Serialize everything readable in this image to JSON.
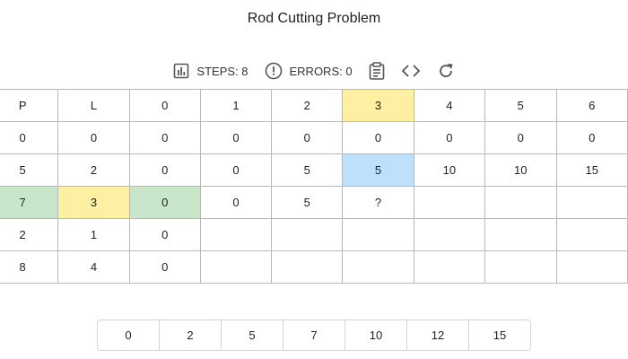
{
  "title": "Rod Cutting Problem",
  "toolbar": {
    "steps_label": "STEPS: 8",
    "errors_label": "ERRORS: 0",
    "icons": [
      "bar-chart-icon",
      "alert-circle-icon",
      "clipboard-icon",
      "code-icon",
      "refresh-icon"
    ]
  },
  "table": {
    "header": [
      "P",
      "L",
      "0",
      "1",
      "2",
      "3",
      "4",
      "5",
      "6"
    ],
    "rows": [
      [
        "0",
        "0",
        "0",
        "0",
        "0",
        "0",
        "0",
        "0",
        "0"
      ],
      [
        "5",
        "2",
        "0",
        "0",
        "5",
        "5",
        "10",
        "10",
        "15"
      ],
      [
        "7",
        "3",
        "0",
        "0",
        "5",
        "?",
        "",
        "",
        ""
      ],
      [
        "2",
        "1",
        "0",
        "",
        "",
        "",
        "",
        "",
        ""
      ],
      [
        "8",
        "4",
        "0",
        "",
        "",
        "",
        "",
        "",
        ""
      ]
    ]
  },
  "highlight_colors": {
    "yellow": "#fdf0a2",
    "green": "#c9e6cb",
    "blue": "#bfe0fa"
  },
  "answers": [
    "0",
    "2",
    "5",
    "7",
    "10",
    "12",
    "15"
  ]
}
